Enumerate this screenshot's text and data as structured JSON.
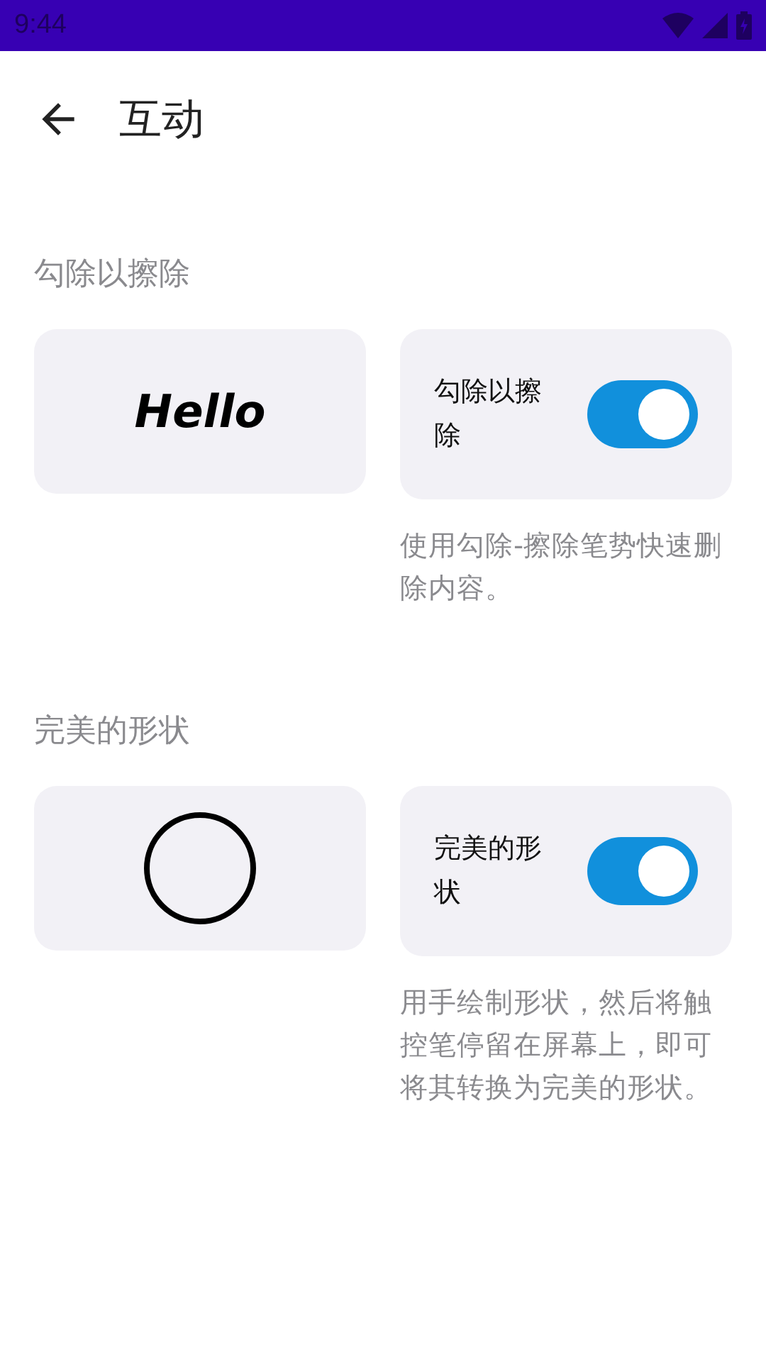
{
  "status_bar": {
    "time": "9:44"
  },
  "toolbar": {
    "title": "互动"
  },
  "sections": [
    {
      "header": "勾除以擦除",
      "preview": {
        "kind": "text",
        "text": "Hello"
      },
      "toggle": {
        "label": "勾除以擦除",
        "on": true
      },
      "description": "使用勾除-擦除笔势快速删除内容。"
    },
    {
      "header": "完美的形状",
      "preview": {
        "kind": "circle"
      },
      "toggle": {
        "label": "完美的形状",
        "on": true
      },
      "description": "用手绘制形状，然后将触控笔停留在屏幕上，即可将其转换为完美的形状。"
    }
  ]
}
